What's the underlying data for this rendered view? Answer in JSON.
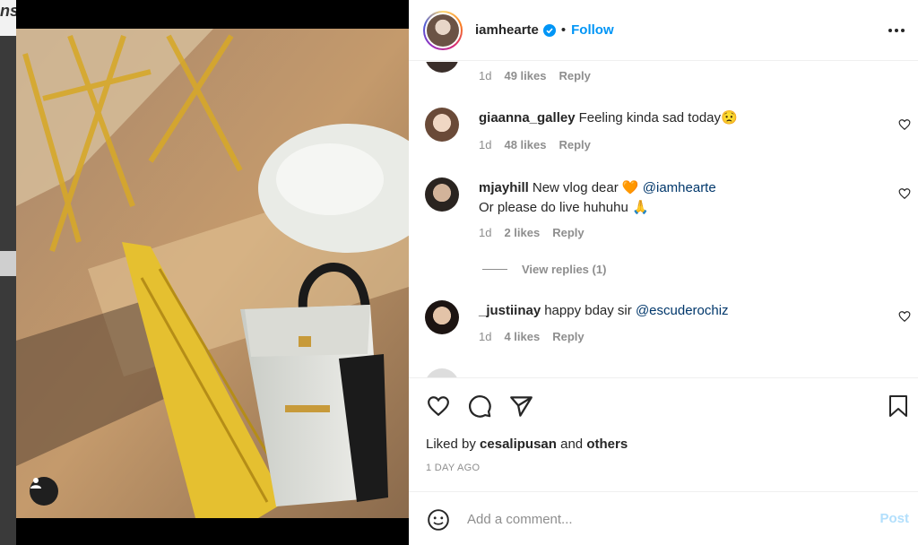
{
  "background": {
    "partial_text": "ns"
  },
  "post": {
    "author": "iamhearte",
    "verified": true,
    "follow_separator": "•",
    "follow_label": "Follow"
  },
  "comments": [
    {
      "user": "",
      "text": "",
      "time": "1d",
      "likes": "49 likes",
      "reply": "Reply",
      "partial": true
    },
    {
      "user": "giaanna_galley",
      "text": "Feeling kinda sad today😟",
      "time": "1d",
      "likes": "48 likes",
      "reply": "Reply"
    },
    {
      "user": "mjayhill",
      "text": "New vlog dear 🧡",
      "mention": "@iamhearte",
      "text2": "Or please do live huhuhu 🙏",
      "time": "1d",
      "likes": "2 likes",
      "reply": "Reply"
    },
    {
      "user": "_justiinay",
      "text": "happy bday sir",
      "mention": "@escuderochiz",
      "time": "1d",
      "likes": "4 likes",
      "reply": "Reply"
    }
  ],
  "view_replies": "View replies (1)",
  "likes": {
    "prefix": "Liked by",
    "user": "cesalipusan",
    "and": "and",
    "others": "others"
  },
  "timestamp": "1 DAY AGO",
  "comment_box": {
    "placeholder": "Add a comment...",
    "post_label": "Post"
  },
  "colors": {
    "link": "#0095f6",
    "post_disabled": "#b2dffc",
    "muted": "#8e8e8e",
    "mention": "#00376b"
  },
  "icons": [
    "verified-badge-icon",
    "more-options-icon",
    "heart-icon",
    "comment-icon",
    "share-icon",
    "bookmark-icon",
    "emoji-icon",
    "user-tag-icon"
  ]
}
